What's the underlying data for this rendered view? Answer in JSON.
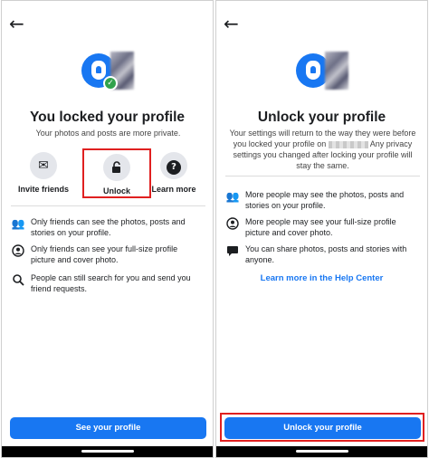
{
  "left": {
    "title": "You locked your profile",
    "subtitle": "Your photos and posts are more private.",
    "actions": [
      {
        "label": "Invite friends",
        "icon": "envelope-icon"
      },
      {
        "label": "Unlock",
        "icon": "unlock-icon"
      },
      {
        "label": "Learn more",
        "icon": "question-icon"
      }
    ],
    "rows": [
      {
        "icon": "friends-icon",
        "text": "Only friends can see the photos, posts and stories on your profile."
      },
      {
        "icon": "profile-icon",
        "text": "Only friends can see your full-size profile picture and cover photo."
      },
      {
        "icon": "search-icon",
        "text": "People can still search for you and send you friend requests."
      }
    ],
    "button": "See your profile"
  },
  "right": {
    "title": "Unlock your profile",
    "desc_part1": "Your settings will return to the way they were before you locked your profile on",
    "desc_part2": "Any privacy settings you changed after locking your profile will stay the same.",
    "rows": [
      {
        "icon": "friends-icon",
        "text": "More people may see the photos, posts and stories on your profile."
      },
      {
        "icon": "profile-icon",
        "text": "More people may see your full-size profile picture and cover photo."
      },
      {
        "icon": "chat-icon",
        "text": "You can share photos, posts and stories with anyone."
      }
    ],
    "link": "Learn more in the Help Center",
    "button": "Unlock your profile"
  },
  "colors": {
    "accent": "#1877f2",
    "highlight": "#e02020",
    "success": "#31a24c"
  }
}
